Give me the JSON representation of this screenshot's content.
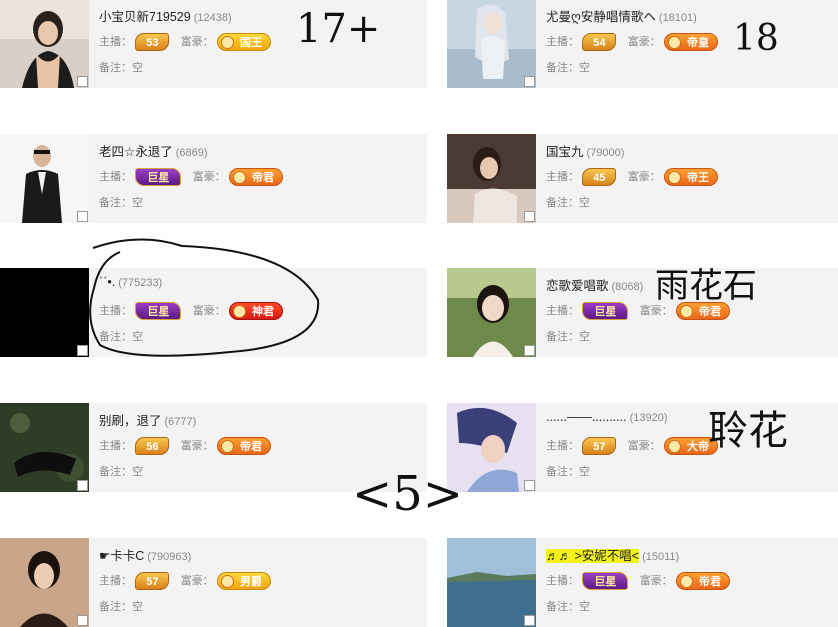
{
  "cards": [
    {
      "name": "小宝贝新719529",
      "uid": "(12438)",
      "host_label": "主播：",
      "host_rank": "53",
      "rich_label": "富豪：",
      "rich_rank": "国王",
      "note_label": "备注：",
      "note": "空"
    },
    {
      "name": "尤曼ღ安静唱情歌ヘ",
      "uid": "(18101)",
      "host_label": "主播：",
      "host_rank": "54",
      "rich_label": "富豪：",
      "rich_rank": "帝皇",
      "note_label": "备注：",
      "note": "空"
    },
    {
      "name": "老四☆永退了",
      "uid": "(6869)",
      "host_label": "主播：",
      "host_rank": "巨星",
      "rich_label": "富豪：",
      "rich_rank": "帝君",
      "note_label": "备注：",
      "note": "空"
    },
    {
      "name": "国宝九",
      "uid": "(79000)",
      "host_label": "主播：",
      "host_rank": "45",
      "rich_label": "富豪：",
      "rich_rank": "帝王",
      "note_label": "备注：",
      "note": "空"
    },
    {
      "name": "ˋˊ•.",
      "uid": "(775233)",
      "host_label": "主播：",
      "host_rank": "巨星",
      "rich_label": "富豪：",
      "rich_rank": "神君",
      "note_label": "备注：",
      "note": "空"
    },
    {
      "name": "恋歌爱唱歌",
      "uid": "(8068)",
      "host_label": "主播：",
      "host_rank": "巨星",
      "rich_label": "富豪：",
      "rich_rank": "帝君",
      "note_label": "备注：",
      "note": "空"
    },
    {
      "name": "别刷，退了",
      "uid": "(6777)",
      "host_label": "主播：",
      "host_rank": "56",
      "rich_label": "富豪：",
      "rich_rank": "帝君",
      "note_label": "备注：",
      "note": "空"
    },
    {
      "name": "......——..........",
      "uid": "(13920)",
      "host_label": "主播：",
      "host_rank": "57",
      "rich_label": "富豪：",
      "rich_rank": "大帝",
      "note_label": "备注：",
      "note": "空"
    },
    {
      "name": "☛卡卡C",
      "uid": "(790963)",
      "host_label": "主播：",
      "host_rank": "57",
      "rich_label": "富豪：",
      "rich_rank": "男爵",
      "note_label": "备注：",
      "note": "空"
    },
    {
      "name": "♬♬ ˃安妮不唱˂",
      "uid": "(15011)",
      "host_label": "主播：",
      "host_rank": "巨星",
      "rich_label": "富豪：",
      "rich_rank": "帝君",
      "note_label": "备注：",
      "note": "空"
    }
  ],
  "annotations": {
    "a1": "17+",
    "a2": "18",
    "a3": "雨花石",
    "a4": "聆花",
    "a5": "<5>"
  },
  "colors": {
    "card_bg": "#f3f3f3",
    "badge_orange": "#e9661a",
    "badge_purple": "#5c1a86",
    "highlight": "#f5f52c"
  }
}
